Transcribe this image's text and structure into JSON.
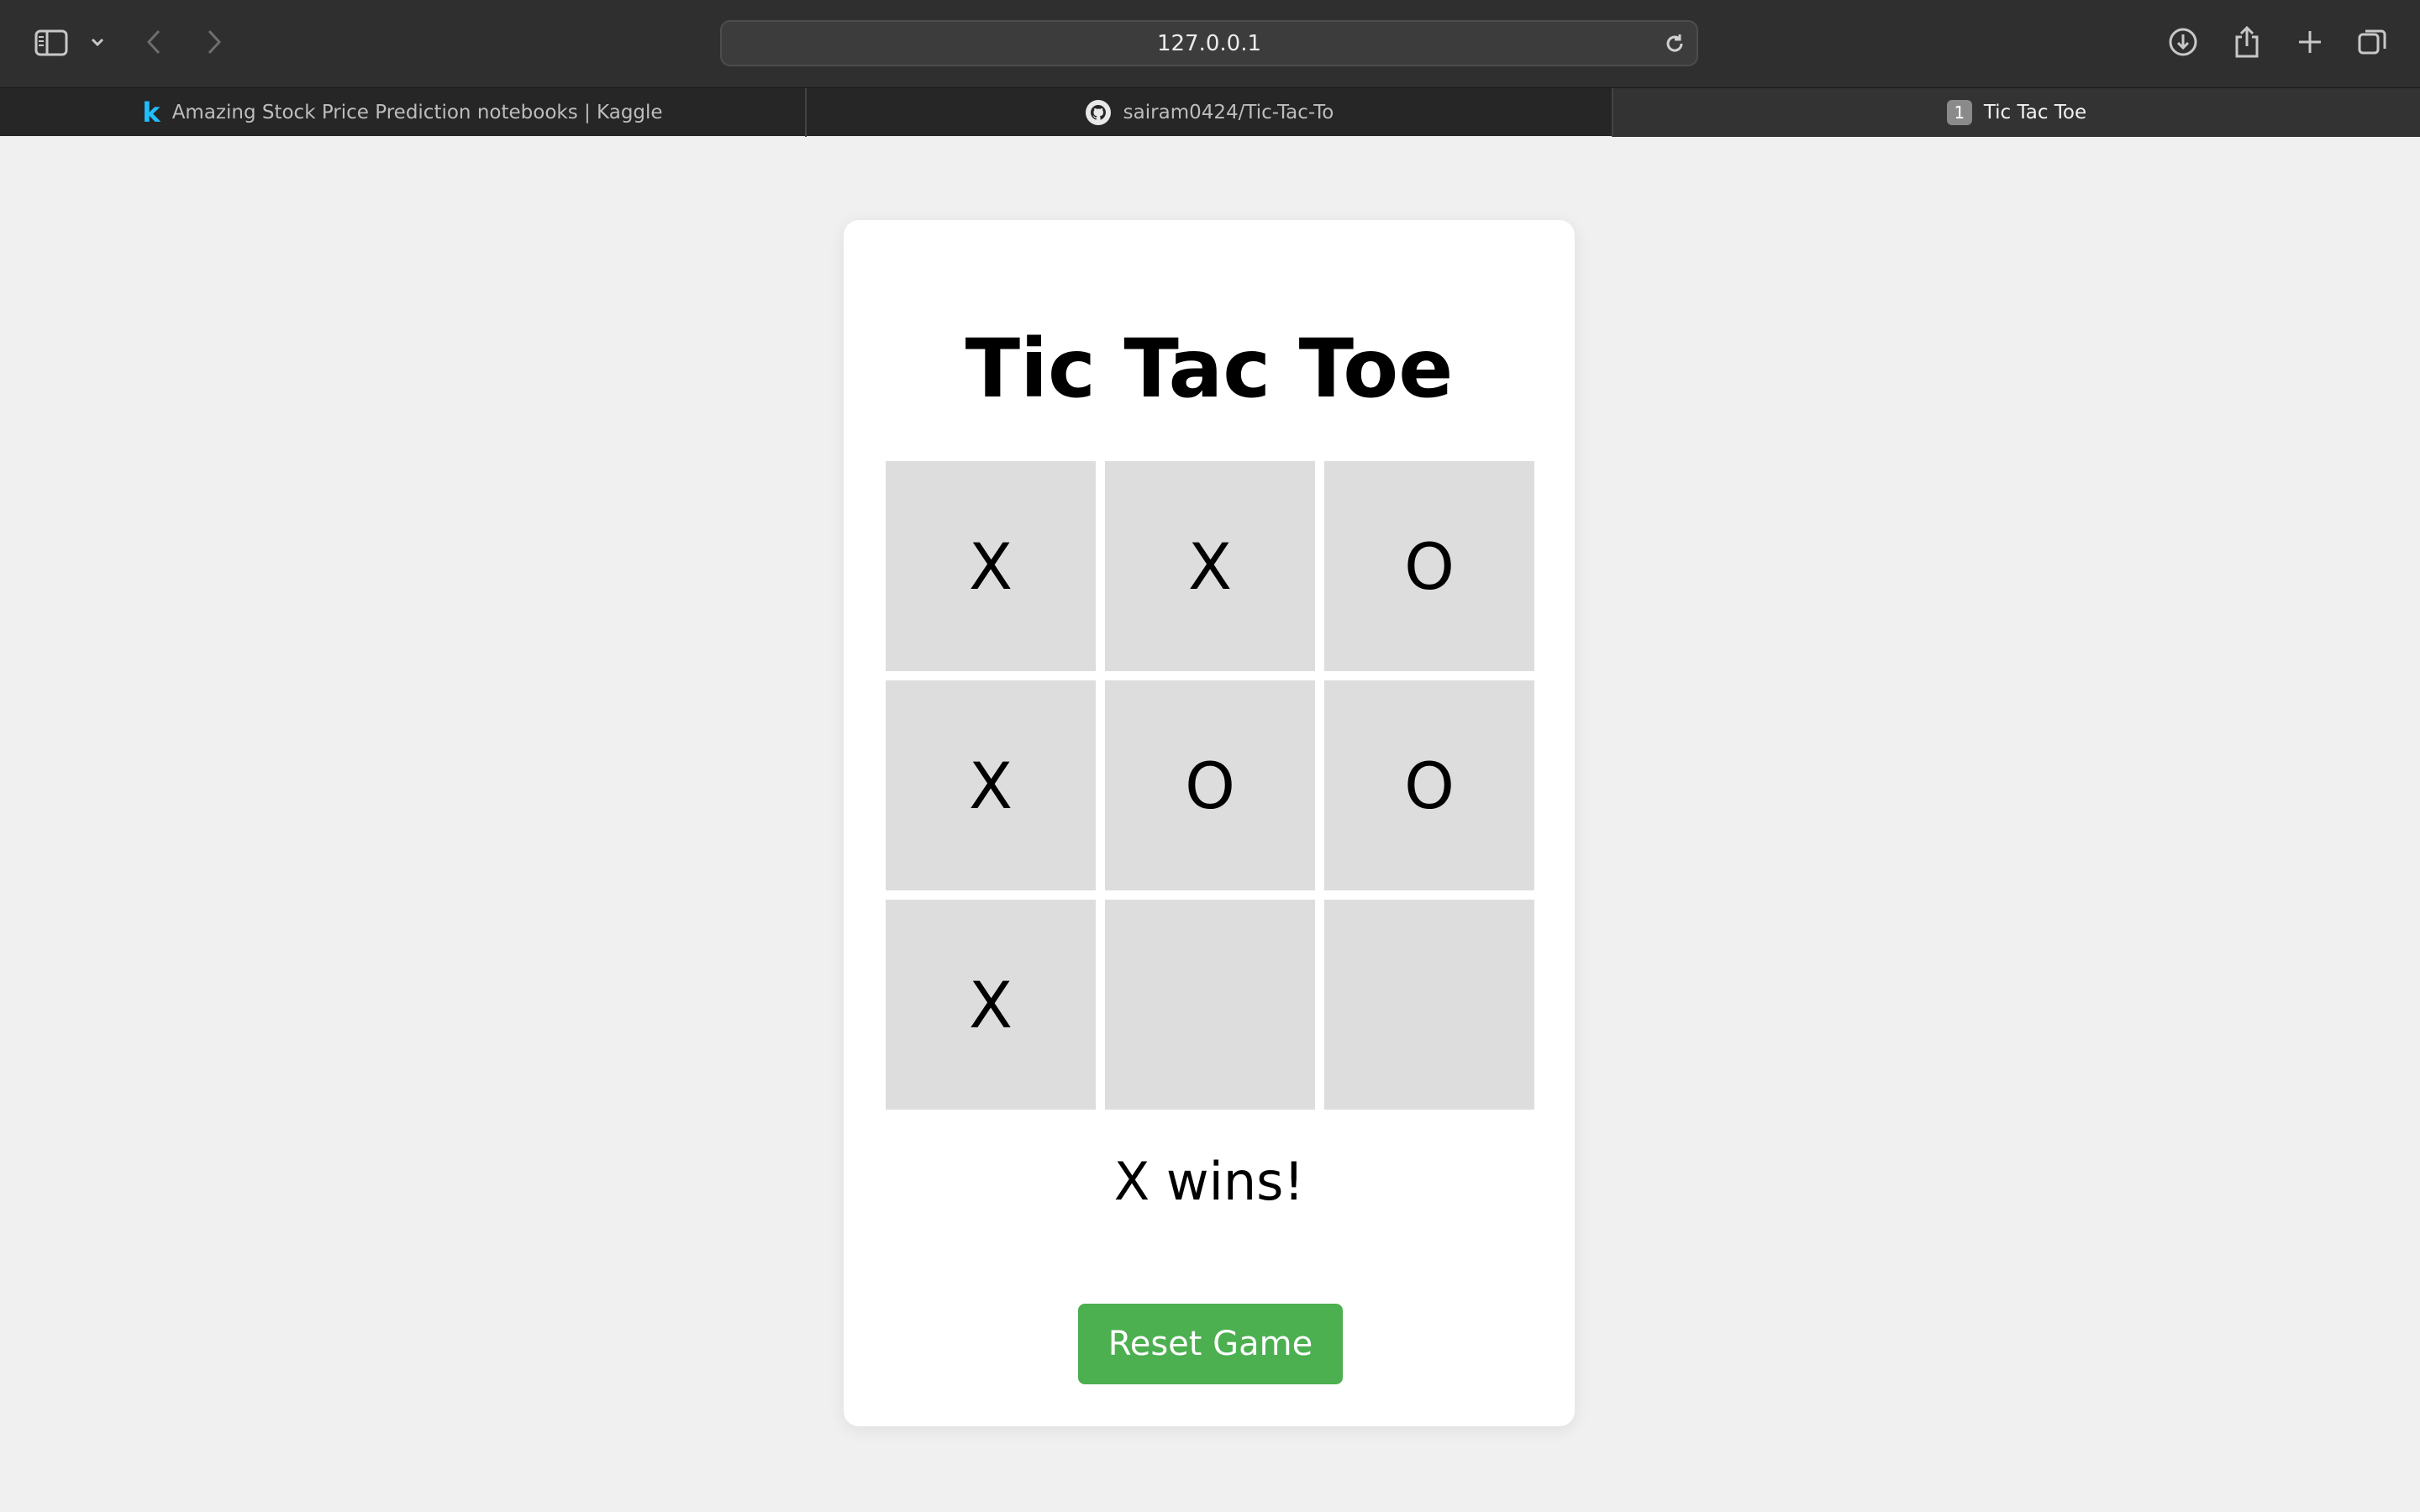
{
  "browser": {
    "address": "127.0.0.1",
    "tabs": [
      {
        "label": "Amazing Stock Price Prediction notebooks | Kaggle",
        "favicon": "kaggle-icon",
        "active": false
      },
      {
        "label": "sairam0424/Tic-Tac-To",
        "favicon": "github-icon",
        "active": false
      },
      {
        "label": "Tic Tac Toe",
        "favicon": "tab-number-badge",
        "badge": "1",
        "active": true
      }
    ]
  },
  "game": {
    "title": "Tic Tac Toe",
    "cells": [
      "X",
      "X",
      "O",
      "X",
      "O",
      "O",
      "X",
      "",
      ""
    ],
    "status": "X wins!",
    "reset_label": "Reset Game"
  },
  "colors": {
    "button": "#4caf50",
    "cell": "#dddddd",
    "page_background": "#f0f0f0"
  }
}
